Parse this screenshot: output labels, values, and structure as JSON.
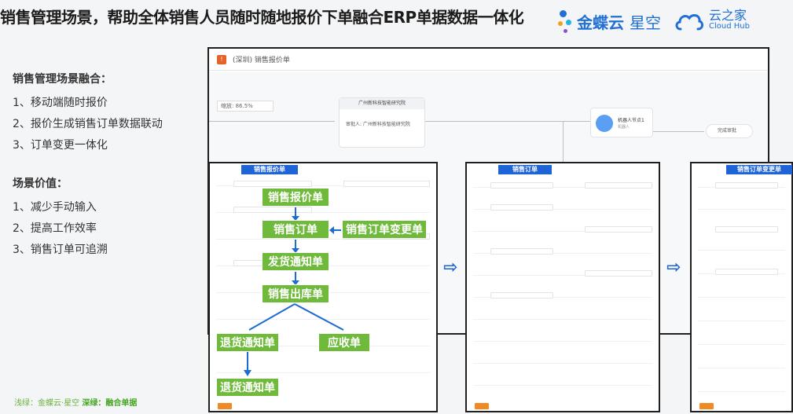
{
  "header": {
    "title": "销售管理场景，帮助全体销售人员随时随地报价下单融合ERP单据数据一体化",
    "kingdee_logo": "金蝶云",
    "kingdee_logo_light": "星空",
    "cloudhub_cn": "云之家",
    "cloudhub_en": "Cloud Hub"
  },
  "left": {
    "section1_title": "销售管理场景融合：",
    "section1_items": [
      "1、移动端随时报价",
      "2、报价生成销售订单数据联动",
      "3、订单变更一体化"
    ],
    "section2_title": "场景价值：",
    "section2_items": [
      "1、减少手动输入",
      "2、提高工作效率",
      "3、销售订单可追溯"
    ]
  },
  "footnote": {
    "light_label": "浅绿：金蝶云·星空",
    "dark_label": "深绿：融合单据"
  },
  "workflow_window": {
    "title": "(深圳) 销售报价单",
    "zoom": "缩放: 86.5%",
    "node_title": "广州新科技智能研究院",
    "node_handler": "审批人: 广州新科技智能研究院",
    "robot_title": "机器人节点1",
    "robot_sub": "机器人",
    "end_label": "完成审批"
  },
  "sub_windows": {
    "quote_tab": "销售报价单",
    "order_tab": "销售订单",
    "change_tab": "销售订单变更单"
  },
  "process": {
    "quote": "销售报价单",
    "order": "销售订单",
    "order_change": "销售订单变更单",
    "delivery_notice": "发货通知单",
    "outbound": "销售出库单",
    "return_notice": "退货通知单",
    "receivable": "应收单",
    "return_notice2": "退货通知单"
  },
  "colors": {
    "title_blue": "#1f6fd6",
    "process_green": "#6fb93b",
    "arrow_blue": "#1e6ccf",
    "tab_blue": "#1f64d6",
    "footnote_green": "#69b33b"
  }
}
